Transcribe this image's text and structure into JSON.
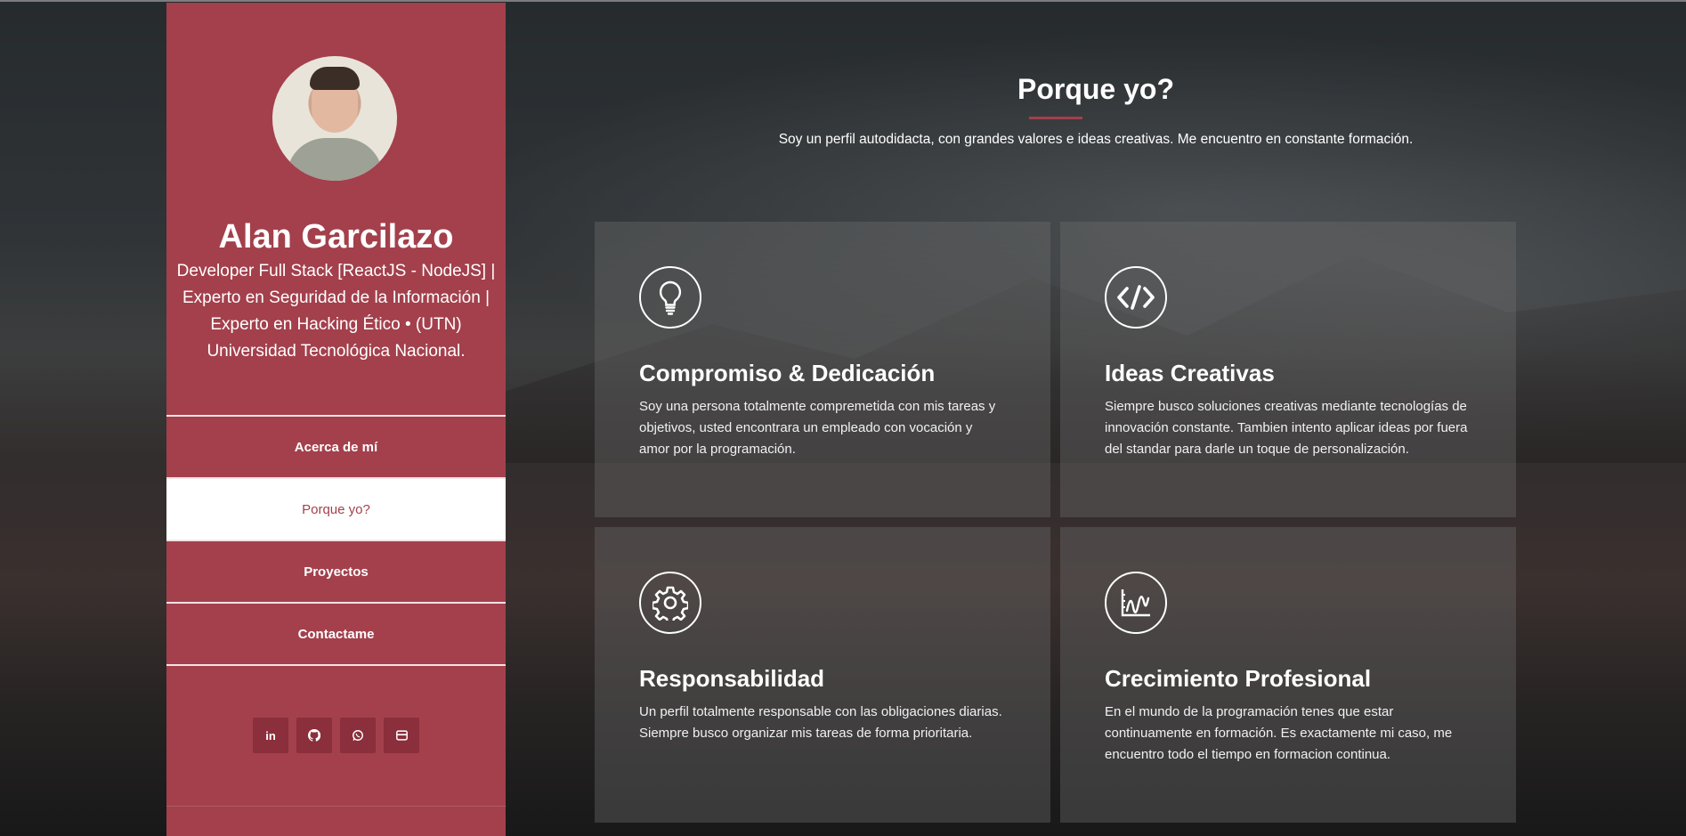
{
  "profile": {
    "name": "Alan Garcilazo",
    "tagline": [
      "Developer Full Stack [ReactJS - NodeJS] |",
      "Experto en Seguridad de la Información |",
      "Experto en Hacking Ético • (UTN)",
      "Universidad Tecnológica Nacional."
    ]
  },
  "nav": [
    {
      "label": "Acerca de mí",
      "active": false
    },
    {
      "label": "Porque yo?",
      "active": true
    },
    {
      "label": "Proyectos",
      "active": false
    },
    {
      "label": "Contactame",
      "active": false
    }
  ],
  "social": [
    {
      "icon": "linkedin-icon",
      "glyph": "in"
    },
    {
      "icon": "github-icon",
      "glyph": ""
    },
    {
      "icon": "whatsapp-icon",
      "glyph": ""
    },
    {
      "icon": "email-icon",
      "glyph": ""
    }
  ],
  "section": {
    "title": "Porque yo?",
    "subtitle": "Soy un perfil autodidacta, con grandes valores e ideas creativas. Me encuentro en constante formación."
  },
  "cards": [
    {
      "icon": "lightbulb-icon",
      "title": "Compromiso & Dedicación",
      "text": "Soy una persona totalmente compremetida con mis tareas y objetivos, usted encontrara un empleado con vocación y amor por la programación."
    },
    {
      "icon": "code-icon",
      "title": "Ideas Creativas",
      "text": "Siempre busco soluciones creativas mediante tecnologías de innovación constante. Tambien intento aplicar ideas por fuera del standar para darle un toque de personalización."
    },
    {
      "icon": "gear-icon",
      "title": "Responsabilidad",
      "text": "Un perfil totalmente responsable con las obligaciones diarias. Siempre busco organizar mis tareas de forma prioritaria."
    },
    {
      "icon": "chart-growth-icon",
      "title": "Crecimiento Profesional",
      "text": "En el mundo de la programación tenes que estar continuamente en formación. Es exactamente mi caso, me encuentro todo el tiempo en formacion continua."
    }
  ]
}
